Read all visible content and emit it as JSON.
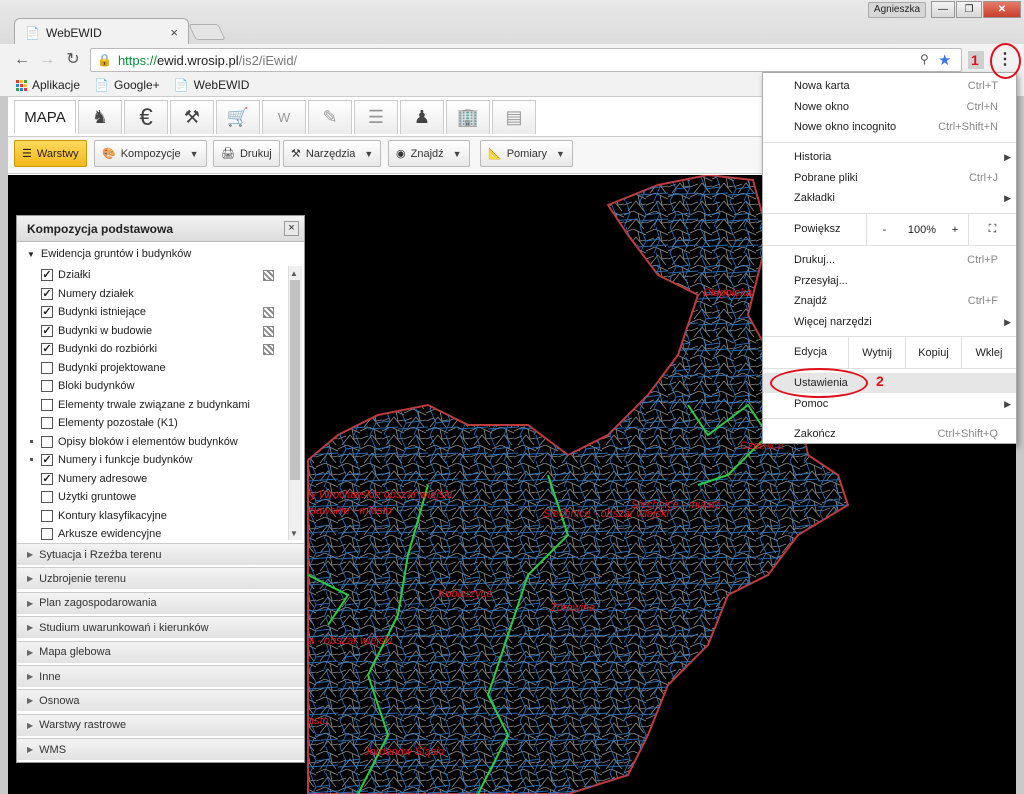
{
  "browser": {
    "tab_title": "WebEWID",
    "tab_close": "×",
    "profile": "Agnieszka",
    "url_scheme": "https://",
    "url_host": "ewid.wrosip.pl",
    "url_path": "/is2/iEwid/",
    "bookmarks": [
      "Aplikacje",
      "Google+",
      "WebEWID"
    ],
    "menu_icon": "⋮"
  },
  "app": {
    "main_tab": "MAPA",
    "module_icons": [
      "surveyor-icon",
      "euro-icon",
      "gavel-icon",
      "cart-icon",
      "w-icon",
      "edit-icon",
      "list-icon",
      "person-icon",
      "building-icon",
      "map-icon"
    ],
    "toolbar": {
      "warstwy": "Warstwy",
      "kompozycje": "Kompozycje",
      "drukuj": "Drukuj",
      "narzedzia": "Narzędzia",
      "znajdz": "Znajdź",
      "pomiary": "Pomiary"
    }
  },
  "panel": {
    "title": "Kompozycja podstawowa",
    "close": "×",
    "group": "Ewidencja gruntów i budynków",
    "layers": [
      {
        "label": "Działki",
        "checked": true,
        "legend": true
      },
      {
        "label": "Numery działek",
        "checked": true,
        "legend": false
      },
      {
        "label": "Budynki istniejące",
        "checked": true,
        "legend": true
      },
      {
        "label": "Budynki w budowie",
        "checked": true,
        "legend": true
      },
      {
        "label": "Budynki do rozbiórki",
        "checked": true,
        "legend": true
      },
      {
        "label": "Budynki projektowane",
        "checked": false,
        "legend": false
      },
      {
        "label": "Bloki budynków",
        "checked": false,
        "legend": false
      },
      {
        "label": "Elementy trwale związane z budynkami",
        "checked": false,
        "legend": false
      },
      {
        "label": "Elementy pozostałe (K1)",
        "checked": false,
        "legend": false
      },
      {
        "label": "Opisy bloków i elementów budynków",
        "checked": false,
        "legend": false,
        "dot": true
      },
      {
        "label": "Numery i funkcje budynków",
        "checked": true,
        "legend": false,
        "dot": true
      },
      {
        "label": "Numery adresowe",
        "checked": true,
        "legend": false
      },
      {
        "label": "Użytki gruntowe",
        "checked": false,
        "legend": false
      },
      {
        "label": "Kontury klasyfikacyjne",
        "checked": false,
        "legend": false
      },
      {
        "label": "Arkusze ewidencyjne",
        "checked": false,
        "legend": false
      }
    ],
    "sections": [
      "Sytuacja i Rzeźba terenu",
      "Uzbrojenie terenu",
      "Plan zagospodarowania",
      "Studium uwarunkowań i kierunków",
      "Mapa glebowa",
      "Inne",
      "Osnowa",
      "Warstwy rastrowe",
      "WMS"
    ]
  },
  "map": {
    "labels": [
      "Długołęka",
      "Czernica",
      "Siechnice - obszar wiejski",
      "Siechnice - miasto",
      "ły Wrocławskie obszar wiejski",
      "cławskie - miasto",
      "Kobierzyce",
      "Żórawina",
      "a - obszar wiejski",
      "asto",
      "Jordanów Śląski"
    ]
  },
  "menu": {
    "items": {
      "nowa_karta": "Nowa karta",
      "nowa_karta_sc": "Ctrl+T",
      "nowe_okno": "Nowe okno",
      "nowe_okno_sc": "Ctrl+N",
      "incognito": "Nowe okno incognito",
      "incognito_sc": "Ctrl+Shift+N",
      "historia": "Historia",
      "pobrane": "Pobrane pliki",
      "pobrane_sc": "Ctrl+J",
      "zakladki": "Zakładki",
      "powieksz": "Powiększ",
      "zoom_minus": "-",
      "zoom_value": "100%",
      "zoom_plus": "+",
      "drukuj": "Drukuj...",
      "drukuj_sc": "Ctrl+P",
      "przesylaj": "Przesyłaj...",
      "znajdz": "Znajdź",
      "znajdz_sc": "Ctrl+F",
      "wiecej": "Więcej narzędzi",
      "edycja": "Edycja",
      "wytnij": "Wytnij",
      "kopiuj": "Kopiuj",
      "wklej": "Wklej",
      "ustawienia": "Ustawienia",
      "pomoc": "Pomoc",
      "zakoncz": "Zakończ",
      "zakoncz_sc": "Ctrl+Shift+Q"
    }
  },
  "annotations": {
    "step1": "1",
    "step2": "2"
  }
}
